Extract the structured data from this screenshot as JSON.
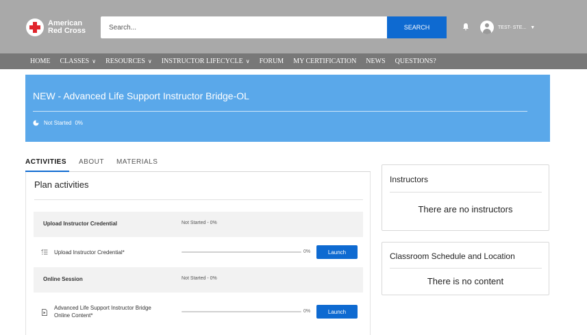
{
  "header": {
    "logo_line1": "American",
    "logo_line2": "Red Cross",
    "search_placeholder": "Search...",
    "search_button": "SEARCH",
    "user_name": "TEST- STE...",
    "brand_color": "#e0242b",
    "accent_color": "#0e6ad1",
    "icons": [
      "red-cross-logo-icon",
      "bell-icon",
      "user-avatar-icon",
      "chevron-down-icon"
    ]
  },
  "nav": {
    "items": [
      {
        "label": "HOME",
        "dropdown": false
      },
      {
        "label": "CLASSES",
        "dropdown": true
      },
      {
        "label": "RESOURCES",
        "dropdown": true
      },
      {
        "label": "INSTRUCTOR LIFECYCLE",
        "dropdown": true
      },
      {
        "label": "FORUM",
        "dropdown": false
      },
      {
        "label": "MY CERTIFICATION",
        "dropdown": false
      },
      {
        "label": "NEWS",
        "dropdown": false
      },
      {
        "label": "QUESTIONS?",
        "dropdown": false
      }
    ]
  },
  "banner": {
    "title": "NEW - Advanced Life Support Instructor Bridge-OL",
    "status": "Not Started",
    "percent": "0%",
    "color": "#5aa8ea"
  },
  "tabs": [
    {
      "label": "ACTIVITIES",
      "active": true
    },
    {
      "label": "ABOUT",
      "active": false
    },
    {
      "label": "MATERIALS",
      "active": false
    }
  ],
  "activities": {
    "title": "Plan activities",
    "sections": [
      {
        "name": "Upload Instructor Credential",
        "status": "Not Started - 0%",
        "items": [
          {
            "name": "Upload Instructor Credential*",
            "icon": "checklist-icon",
            "progress": 0,
            "percent_label": "0%",
            "button": "Launch"
          }
        ]
      },
      {
        "name": "Online Session",
        "status": "Not Started - 0%",
        "items": [
          {
            "name_line1": "Advanced Life Support Instructor Bridge",
            "name_line2": "Online Content*",
            "icon": "document-icon",
            "progress": 0,
            "percent_label": "0%",
            "button": "Launch"
          }
        ]
      }
    ]
  },
  "instructors": {
    "title": "Instructors",
    "empty": "There are no instructors"
  },
  "schedule": {
    "title": "Classroom Schedule and Location",
    "empty": "There is no content"
  }
}
